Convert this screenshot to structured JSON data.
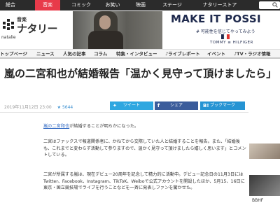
{
  "topbar": {
    "categories": [
      {
        "label": "総合",
        "active": false
      },
      {
        "label": "音楽",
        "active": true
      },
      {
        "label": "コミック",
        "active": false
      },
      {
        "label": "お笑い",
        "active": false
      },
      {
        "label": "映画",
        "active": false
      },
      {
        "label": "ステージ",
        "active": false
      },
      {
        "label": "ナタリーストア",
        "active": false
      }
    ],
    "accent_color": "#e83a4a"
  },
  "logo": {
    "sub": "音楽",
    "name": "ナタリー",
    "en": "natalie"
  },
  "ad": {
    "headline_a": "MAKE IT POSSI",
    "tagline": "# 可能性を信じてやってみよう",
    "brand": "TOMMY ≡ HILFIGER"
  },
  "nav": {
    "items": [
      "トップページ",
      "ニュース",
      "人気の記事",
      "コラム",
      "特集・インタビュー",
      "♪ライブレポート",
      "イベント",
      "♪TV・ラジオ情報"
    ]
  },
  "article": {
    "title": "嵐の二宮和也が結婚報告「温かく見守って頂けましたら」",
    "date": "2019年11月12日 23:00",
    "stars": "★ 5644",
    "p1_link": "嵐の二宮和也",
    "p1_rest": "が結婚することが明らかになった。",
    "p2": "二宮はファックスで報道関係者に、かねてから交際していた人と結婚することを報告。また、「結婚後も、これまでと変わらず活動して参りますので、温かく見守って頂けましたら嬉しく思います」とコメントしている。",
    "p3": "二宮が所属する嵐は、現在デビュー20周年を記念して精力的に活動中。デビュー記念日の11月3日にはTwitter、Facebook、Instagram、TikToK、Weiboで公式アカウントを開設したほか、5月15、16日に東京・国立競技場でライブを行うことなどを一斉に発表しファンを驚かせた。"
  },
  "share": {
    "twitter": "ツイート",
    "facebook": "シェア",
    "hatena": "ブックマーク"
  },
  "side": {
    "label": "BBHF"
  }
}
